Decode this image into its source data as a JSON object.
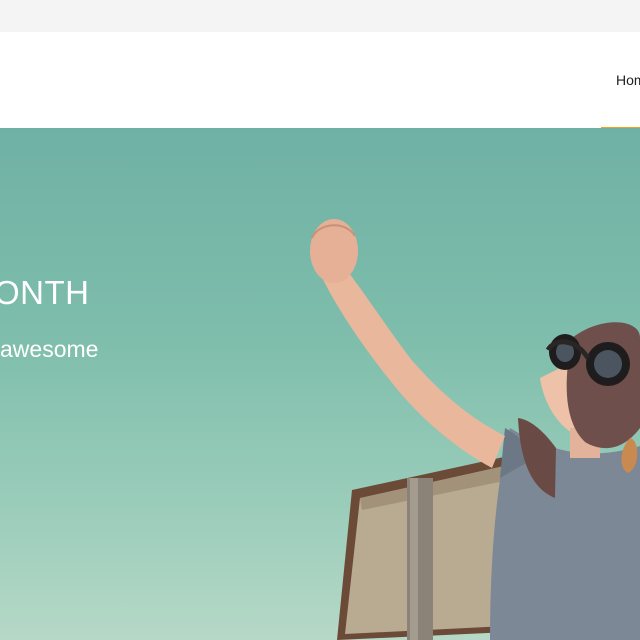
{
  "nav": {
    "items": [
      {
        "label": "Hom"
      }
    ]
  },
  "hero": {
    "title": "ONTH",
    "subtitle": "awesome",
    "image_subject": "child with aviator goggles and cardboard jetpack raising fist to the sky"
  },
  "colors": {
    "accent": "#f0a21c",
    "sky_top": "#6fb1a5",
    "sky_bottom": "#b6d8c7"
  }
}
